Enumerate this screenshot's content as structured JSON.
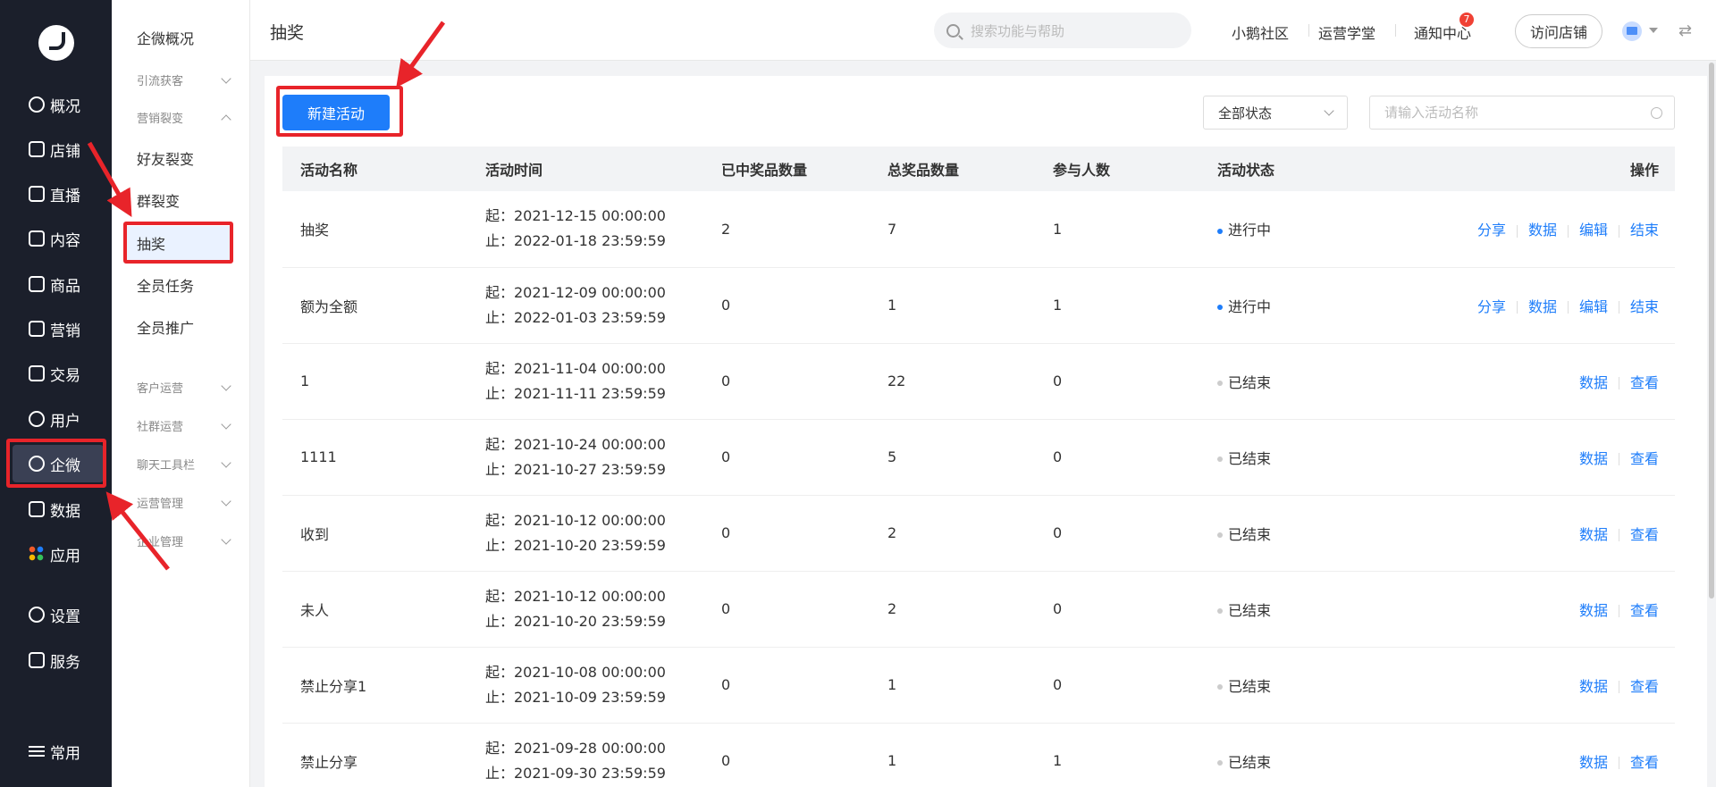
{
  "sidebar": {
    "items": [
      {
        "label": "概况",
        "icon": "chart-pie-icon"
      },
      {
        "label": "店铺",
        "icon": "store-icon"
      },
      {
        "label": "直播",
        "icon": "live-icon"
      },
      {
        "label": "内容",
        "icon": "document-icon"
      },
      {
        "label": "商品",
        "icon": "box-icon"
      },
      {
        "label": "营销",
        "icon": "megaphone-icon"
      },
      {
        "label": "交易",
        "icon": "transaction-icon"
      },
      {
        "label": "用户",
        "icon": "user-icon"
      },
      {
        "label": "企微",
        "icon": "wecom-icon"
      },
      {
        "label": "数据",
        "icon": "data-icon"
      },
      {
        "label": "应用",
        "icon": "apps-icon"
      },
      {
        "label": "设置",
        "icon": "gear-icon"
      },
      {
        "label": "服务",
        "icon": "service-icon"
      },
      {
        "label": "常用",
        "icon": "menu-icon"
      }
    ]
  },
  "subnav": {
    "overview": "企微概况",
    "groups": {
      "traffic": "引流获客",
      "marketing": "营销裂变",
      "customer": "客户运营",
      "community": "社群运营",
      "chat_tools": "聊天工具栏",
      "ops_mgmt": "运营管理",
      "enterprise": "企业管理"
    },
    "items": {
      "friend_fission": "好友裂变",
      "group_fission": "群裂变",
      "lottery": "抽奖",
      "all_tasks": "全员任务",
      "all_promo": "全员推广"
    }
  },
  "header": {
    "title": "抽奖",
    "search_placeholder": "搜索功能与帮助",
    "links": {
      "community": "小鹅社区",
      "academy": "运营学堂",
      "notify": "通知中心"
    },
    "notify_count": "7",
    "visit_store": "访问店铺"
  },
  "toolbar": {
    "new_button": "新建活动",
    "status_select": "全部状态",
    "name_placeholder": "请输入活动名称"
  },
  "table": {
    "headers": {
      "name": "活动名称",
      "time": "活动时间",
      "won": "已中奖品数量",
      "total": "总奖品数量",
      "participants": "参与人数",
      "status": "活动状态",
      "actions": "操作"
    },
    "rows": [
      {
        "name": "抽奖",
        "start": "起：2021-12-15 00:00:00",
        "end": "止：2022-01-18 23:59:59",
        "won": "2",
        "total": "7",
        "participants": "1",
        "status": "进行中",
        "ops": [
          "分享",
          "数据",
          "编辑",
          "结束"
        ]
      },
      {
        "name": "额为全额",
        "start": "起：2021-12-09 00:00:00",
        "end": "止：2022-01-03 23:59:59",
        "won": "0",
        "total": "1",
        "participants": "1",
        "status": "进行中",
        "ops": [
          "分享",
          "数据",
          "编辑",
          "结束"
        ]
      },
      {
        "name": "1",
        "start": "起：2021-11-04 00:00:00",
        "end": "止：2021-11-11 23:59:59",
        "won": "0",
        "total": "22",
        "participants": "0",
        "status": "已结束",
        "ops": [
          "数据",
          "查看"
        ]
      },
      {
        "name": "1111",
        "start": "起：2021-10-24 00:00:00",
        "end": "止：2021-10-27 23:59:59",
        "won": "0",
        "total": "5",
        "participants": "0",
        "status": "已结束",
        "ops": [
          "数据",
          "查看"
        ]
      },
      {
        "name": "收到",
        "start": "起：2021-10-12 00:00:00",
        "end": "止：2021-10-20 23:59:59",
        "won": "0",
        "total": "2",
        "participants": "0",
        "status": "已结束",
        "ops": [
          "数据",
          "查看"
        ]
      },
      {
        "name": "未人",
        "start": "起：2021-10-12 00:00:00",
        "end": "止：2021-10-20 23:59:59",
        "won": "0",
        "total": "2",
        "participants": "0",
        "status": "已结束",
        "ops": [
          "数据",
          "查看"
        ]
      },
      {
        "name": "禁止分享1",
        "start": "起：2021-10-08 00:00:00",
        "end": "止：2021-10-09 23:59:59",
        "won": "0",
        "total": "1",
        "participants": "0",
        "status": "已结束",
        "ops": [
          "数据",
          "查看"
        ]
      },
      {
        "name": "禁止分享",
        "start": "起：2021-09-28 00:00:00",
        "end": "止：2021-09-30 23:59:59",
        "won": "0",
        "total": "1",
        "participants": "1",
        "status": "已结束",
        "ops": [
          "数据",
          "查看"
        ]
      }
    ]
  },
  "colors": {
    "accent": "#1e7dfa",
    "active_dot": "#1e7dfa",
    "ended_dot": "#cccccc",
    "annotation": "#e8242a",
    "sidebar_bg": "#1b1f2b"
  }
}
